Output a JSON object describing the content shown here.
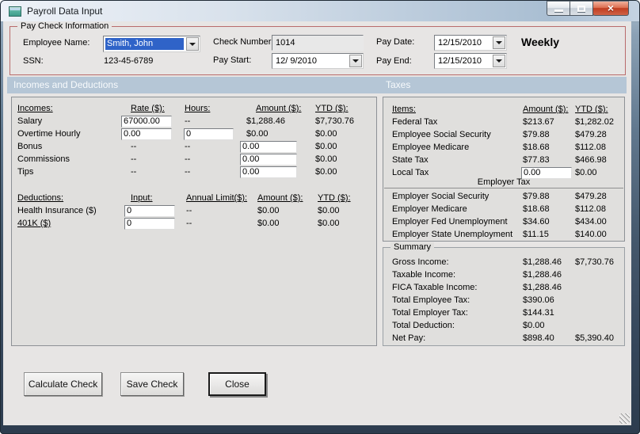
{
  "window": {
    "title": "Payroll Data Input",
    "close_glyph": "×"
  },
  "paycheck": {
    "group_title": "Pay Check Information",
    "fields": {
      "employee_name": {
        "label": "Employee Name:",
        "value": "Smith, John"
      },
      "ssn": {
        "label": "SSN:",
        "value": "123-45-6789"
      },
      "check_number": {
        "label": "Check Number:",
        "value": "1014"
      },
      "pay_start": {
        "label": "Pay Start:",
        "value": "12/ 9/2010"
      },
      "pay_date": {
        "label": "Pay Date:",
        "value": "12/15/2010"
      },
      "pay_end": {
        "label": "Pay End:",
        "value": "12/15/2010"
      }
    },
    "frequency": "Weekly"
  },
  "section_headers": {
    "incomes_deductions": "Incomes and Deductions",
    "taxes": "Taxes"
  },
  "incomes": {
    "headers": {
      "item": "Incomes:",
      "rate": "Rate ($):",
      "hours": "Hours:",
      "amount": "Amount ($):",
      "ytd": "YTD ($):"
    },
    "rows": [
      {
        "label": "Salary",
        "rate_input": "67000.00",
        "hours": "--",
        "amount": "$1,288.46",
        "ytd": "$7,730.76"
      },
      {
        "label": "Overtime Hourly",
        "rate_input": "0.00",
        "hours_input": "0",
        "amount": "$0.00",
        "ytd": "$0.00"
      },
      {
        "label": "Bonus",
        "rate": "--",
        "hours": "--",
        "amount_input": "0.00",
        "ytd": "$0.00"
      },
      {
        "label": "Commissions",
        "rate": "--",
        "hours": "--",
        "amount_input": "0.00",
        "ytd": "$0.00"
      },
      {
        "label": "Tips",
        "rate": "--",
        "hours": "--",
        "amount_input": "0.00",
        "ytd": "$0.00"
      }
    ]
  },
  "deductions": {
    "headers": {
      "item": "Deductions:",
      "input": "Input:",
      "limit": "Annual Limit($):",
      "amount": "Amount ($):",
      "ytd": "YTD ($):"
    },
    "rows": [
      {
        "label": "Health Insurance  ($)",
        "input": "0",
        "limit": "--",
        "amount": "$0.00",
        "ytd": "$0.00"
      },
      {
        "label": "401K  ($)",
        "input": "0",
        "limit": "--",
        "amount": "$0.00",
        "ytd": "$0.00"
      }
    ]
  },
  "taxes": {
    "headers": {
      "item": "Items:",
      "amount": "Amount ($):",
      "ytd": "YTD ($):"
    },
    "employee_rows": [
      {
        "label": "Federal Tax",
        "amount": "$213.67",
        "ytd": "$1,282.02"
      },
      {
        "label": "Employee Social Security",
        "amount": "$79.88",
        "ytd": "$479.28"
      },
      {
        "label": "Employee Medicare",
        "amount": "$18.68",
        "ytd": "$112.08"
      },
      {
        "label": "State Tax",
        "amount": "$77.83",
        "ytd": "$466.98"
      },
      {
        "label": "Local Tax",
        "amount_input": "0.00",
        "ytd": "$0.00"
      }
    ],
    "employer_header": "Employer Tax",
    "employer_rows": [
      {
        "label": "Employer Social Security",
        "amount": "$79.88",
        "ytd": "$479.28"
      },
      {
        "label": "Employer Medicare",
        "amount": "$18.68",
        "ytd": "$112.08"
      },
      {
        "label": "Employer Fed Unemployment",
        "amount": "$34.60",
        "ytd": "$434.00"
      },
      {
        "label": "Employer State Unemployment",
        "amount": "$11.15",
        "ytd": "$140.00"
      }
    ]
  },
  "summary": {
    "group_title": "Summary",
    "rows": [
      {
        "label": "Gross Income:",
        "amount": "$1,288.46",
        "ytd": "$7,730.76"
      },
      {
        "label": "Taxable Income:",
        "amount": "$1,288.46",
        "ytd": ""
      },
      {
        "label": "FICA Taxable Income:",
        "amount": "$1,288.46",
        "ytd": ""
      },
      {
        "label": "Total Employee Tax:",
        "amount": "$390.06",
        "ytd": ""
      },
      {
        "label": "Total Employer Tax:",
        "amount": "$144.31",
        "ytd": ""
      },
      {
        "label": "Total Deduction:",
        "amount": "$0.00",
        "ytd": ""
      },
      {
        "label": "Net Pay:",
        "amount": "$898.40",
        "ytd": "$5,390.40"
      }
    ]
  },
  "buttons": {
    "calculate": "Calculate Check",
    "save": "Save Check",
    "close": "Close"
  },
  "colors": {
    "section_band": "#b5c6d6",
    "group_border": "#b96b6b",
    "selection_highlight": "#2f63c8",
    "close_button_red": "#c03d20"
  }
}
